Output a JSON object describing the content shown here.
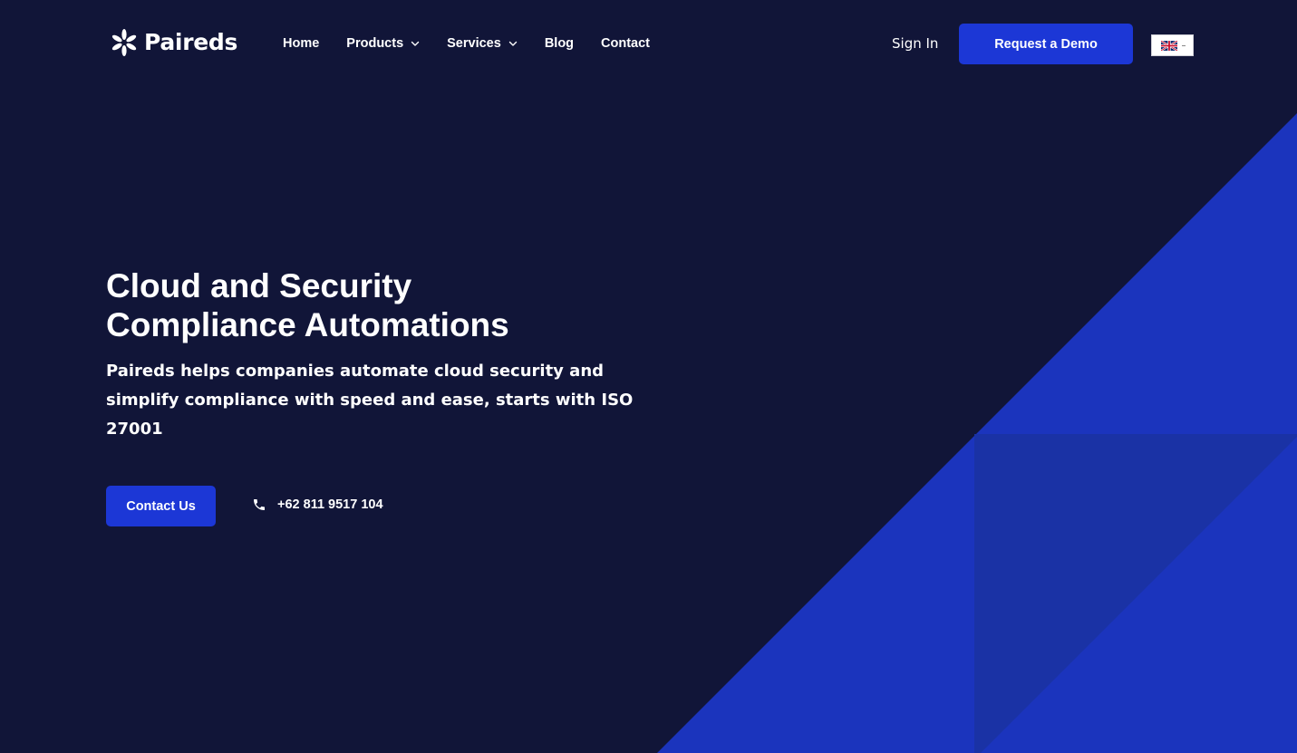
{
  "brand": {
    "name": "Paireds",
    "logo_icon": "asterisk-logo-icon"
  },
  "nav": {
    "items": [
      {
        "label": "Home",
        "has_dropdown": false
      },
      {
        "label": "Products",
        "has_dropdown": true
      },
      {
        "label": "Services",
        "has_dropdown": true
      },
      {
        "label": "Blog",
        "has_dropdown": false
      },
      {
        "label": "Contact",
        "has_dropdown": false
      }
    ]
  },
  "header_actions": {
    "signin_label": "Sign In",
    "demo_label": "Request a Demo",
    "language": {
      "icon": "uk-flag-icon",
      "selected": "-"
    }
  },
  "hero": {
    "title_line1": "Cloud and Security",
    "title_line2": "Compliance Automations",
    "subtitle": "Paireds helps companies automate cloud security and simplify compliance with speed and ease, starts with ISO 27001",
    "contact_label": "Contact Us",
    "phone": "+62 811 9517 104",
    "phone_icon": "phone-icon"
  },
  "colors": {
    "background": "#111538",
    "accent": "#1c37d6",
    "shape_primary": "#1b34bd",
    "shape_secondary": "#1a32a8"
  }
}
